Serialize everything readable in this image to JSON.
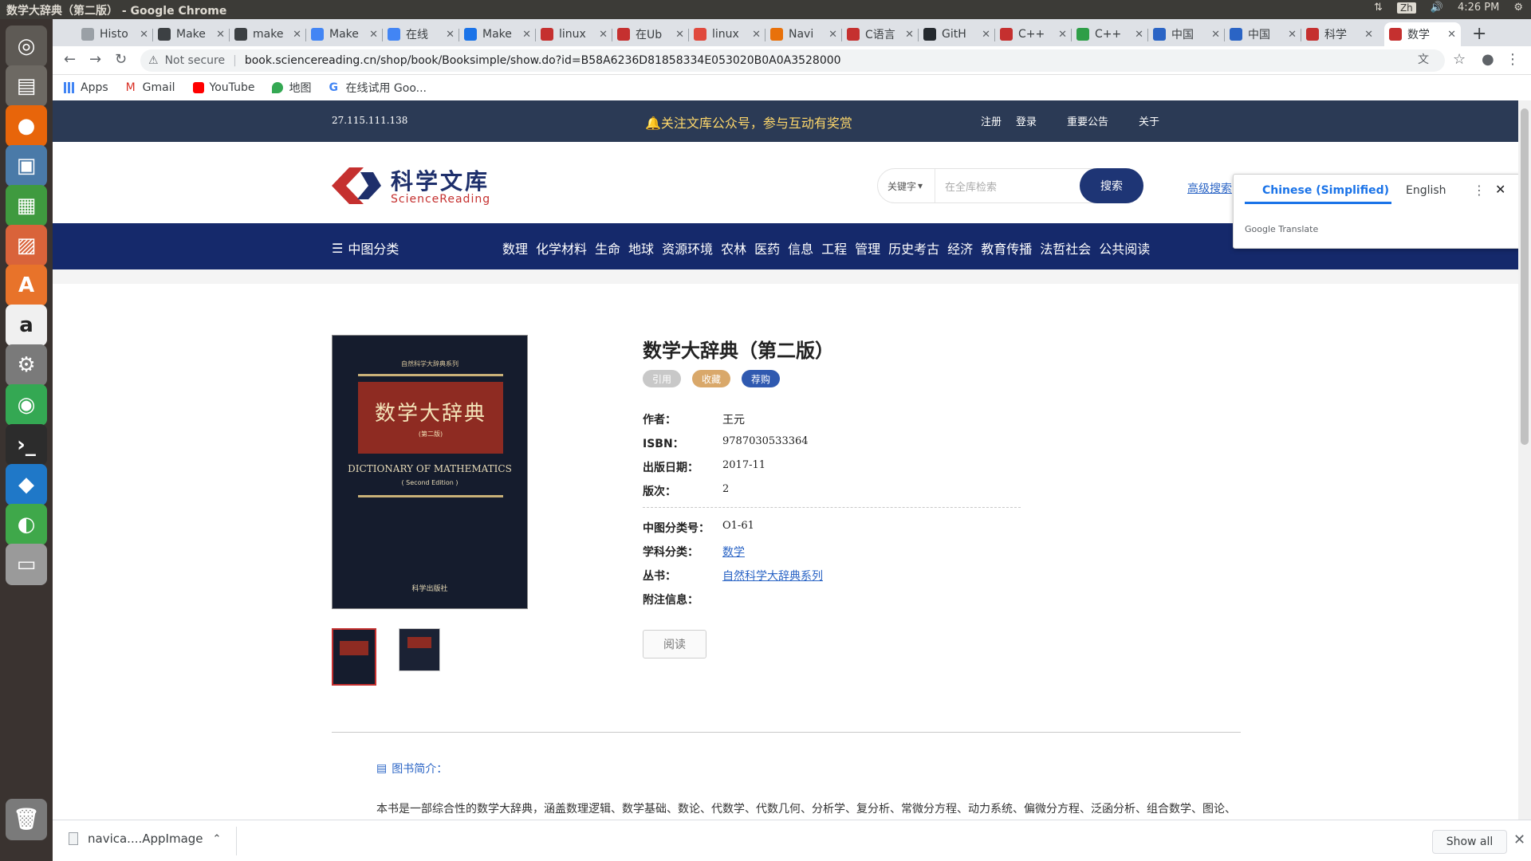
{
  "system": {
    "window_title": "数学大辞典（第二版） - Google Chrome",
    "ime": "Zh",
    "time": "4:26 PM"
  },
  "tabs": [
    {
      "label": "Histo",
      "color": "#9aa0a6"
    },
    {
      "label": "Make",
      "color": "#3c4043"
    },
    {
      "label": "make",
      "color": "#3c4043"
    },
    {
      "label": "Make",
      "color": "#4285f4"
    },
    {
      "label": "在线",
      "color": "#4285f4"
    },
    {
      "label": "Make",
      "color": "#1a73e8"
    },
    {
      "label": "linux",
      "color": "#c5302f"
    },
    {
      "label": "在Ub",
      "color": "#c5302f"
    },
    {
      "label": "linux",
      "color": "#e0493d"
    },
    {
      "label": "Navi",
      "color": "#e8710a"
    },
    {
      "label": "C语言",
      "color": "#c5302f"
    },
    {
      "label": "GitH",
      "color": "#24292e"
    },
    {
      "label": "C++",
      "color": "#c5302f"
    },
    {
      "label": "C++",
      "color": "#2e9e47"
    },
    {
      "label": "中国",
      "color": "#2a64c5"
    },
    {
      "label": "中国",
      "color": "#2a64c5"
    },
    {
      "label": "科学",
      "color": "#c5302f"
    },
    {
      "label": "数学",
      "color": "#c5302f"
    }
  ],
  "toolbar": {
    "security": "Not secure",
    "url": "book.sciencereading.cn/shop/book/Booksimple/show.do?id=B58A6236D81858334E053020B0A0A3528000"
  },
  "bookmarks": [
    {
      "label": "Apps"
    },
    {
      "label": "Gmail"
    },
    {
      "label": "YouTube"
    },
    {
      "label": "地图"
    },
    {
      "label": "在线试用 Goo..."
    }
  ],
  "site": {
    "ip": "27.115.111.138",
    "notice": "关注文库公众号，参与互动有奖赏",
    "links": [
      "注册",
      "登录",
      "重要公告",
      "关于"
    ],
    "logo_cn": "科学文库",
    "logo_en": "ScienceReading",
    "search_keyword": "关键字",
    "search_placeholder": "在全库检索",
    "search_button": "搜索",
    "advanced_search": "高级搜索",
    "category_menu": "中图分类",
    "categories": [
      "数理",
      "化学材料",
      "生命",
      "地球",
      "资源环境",
      "农林",
      "医药",
      "信息",
      "工程",
      "管理",
      "历史考古",
      "经济",
      "教育传播",
      "法哲社会",
      "公共阅读"
    ]
  },
  "book": {
    "title": "数学大辞典（第二版）",
    "buttons": {
      "cite": "引用",
      "favorite": "收藏",
      "buy": "荐购"
    },
    "fields": {
      "author_label": "作者：",
      "author": "王元",
      "isbn_label": "ISBN：",
      "isbn": "9787030533364",
      "date_label": "出版日期：",
      "date": "2017-11",
      "edition_label": "版次：",
      "edition": "2",
      "clc_label": "中图分类号：",
      "clc": "O1-61",
      "subject_label": "学科分类：",
      "subject": "数学",
      "series_label": "丛书：",
      "series": "自然科学大辞典系列",
      "note_label": "附注信息："
    },
    "read_button": "阅读",
    "cover": {
      "series": "自然科学大辞典系列",
      "title": "数学大辞典",
      "edition": "(第二版)",
      "title_en": "DICTIONARY OF MATHEMATICS",
      "edition_en": "( Second Edition )",
      "publisher": "科学出版社"
    },
    "intro_heading": "图书简介：",
    "intro_text": "本书是一部综合性的数学大辞典，涵盖数理逻辑、数学基础、数论、代数学、代数几何、分析学、复分析、常微分方程、动力系统、偏微分方程、泛函分析、组合数学、图论、"
  },
  "translate": {
    "lang_from": "Chinese (Simplified)",
    "lang_to": "English",
    "brand": "Google Translate"
  },
  "downloads": {
    "file": "navica....AppImage",
    "show_all": "Show all"
  }
}
